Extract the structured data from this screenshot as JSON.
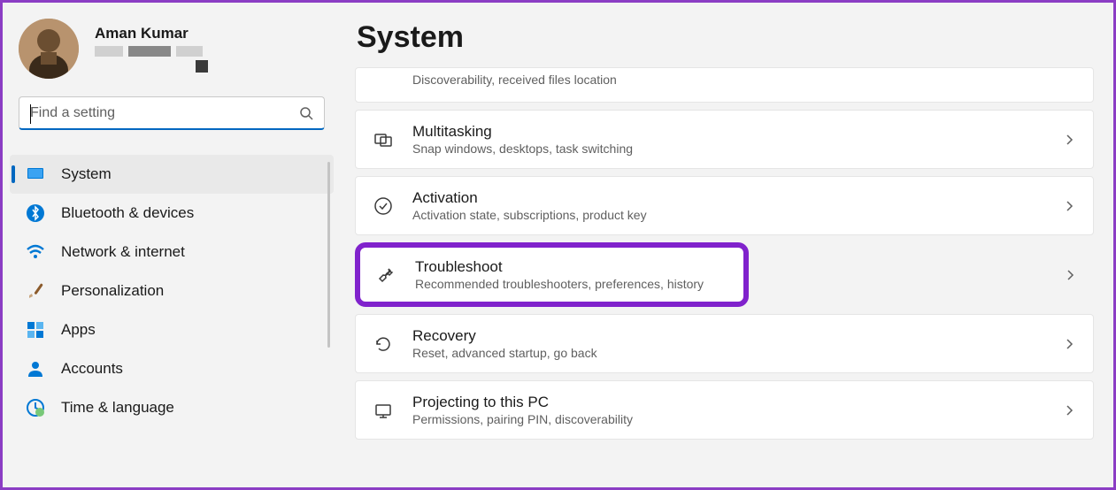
{
  "profile": {
    "name": "Aman Kumar"
  },
  "search": {
    "placeholder": "Find a setting"
  },
  "nav": [
    {
      "id": "system",
      "label": "System",
      "active": true
    },
    {
      "id": "bluetooth",
      "label": "Bluetooth & devices"
    },
    {
      "id": "network",
      "label": "Network & internet"
    },
    {
      "id": "personalization",
      "label": "Personalization"
    },
    {
      "id": "apps",
      "label": "Apps"
    },
    {
      "id": "accounts",
      "label": "Accounts"
    },
    {
      "id": "time-language",
      "label": "Time & language"
    }
  ],
  "page": {
    "title": "System"
  },
  "cards": [
    {
      "id": "nearby",
      "title": "",
      "desc": "Discoverability, received files location",
      "partial": true
    },
    {
      "id": "multitasking",
      "title": "Multitasking",
      "desc": "Snap windows, desktops, task switching"
    },
    {
      "id": "activation",
      "title": "Activation",
      "desc": "Activation state, subscriptions, product key"
    },
    {
      "id": "troubleshoot",
      "title": "Troubleshoot",
      "desc": "Recommended troubleshooters, preferences, history",
      "highlight": true
    },
    {
      "id": "recovery",
      "title": "Recovery",
      "desc": "Reset, advanced startup, go back"
    },
    {
      "id": "projecting",
      "title": "Projecting to this PC",
      "desc": "Permissions, pairing PIN, discoverability"
    }
  ]
}
